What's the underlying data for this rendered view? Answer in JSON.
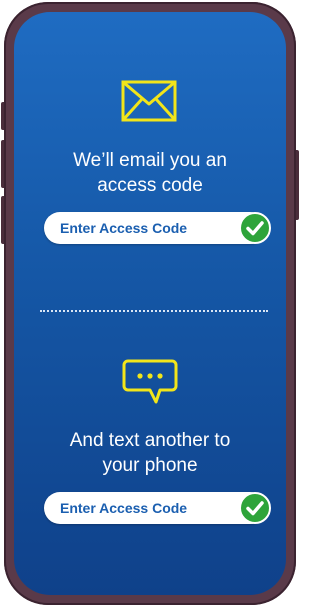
{
  "email_section": {
    "icon": "envelope-icon",
    "caption_line1": "We’ll email you an",
    "caption_line2": "access code",
    "pill_label": "Enter Access Code"
  },
  "text_section": {
    "icon": "chat-bubble-icon",
    "caption_line1": "And text another to",
    "caption_line2": "your phone",
    "pill_label": "Enter Access Code"
  },
  "colors": {
    "icon_yellow": "#f2e51a",
    "check_green": "#2ea43a",
    "screen_blue": "#1557a6",
    "pill_text": "#1b5fb0"
  }
}
